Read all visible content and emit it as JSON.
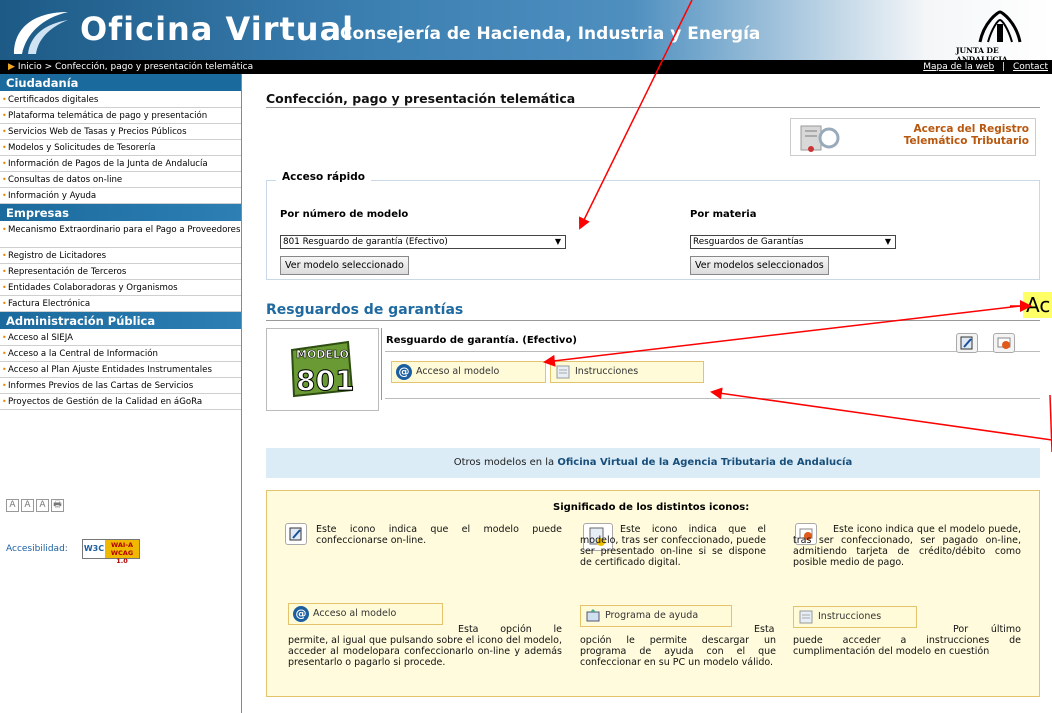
{
  "header": {
    "title": "Oficina Virtual",
    "subtitle": "Consejería de Hacienda, Industria y Energía",
    "junta_label": "JUNTA DE ANDALUCIA"
  },
  "navbar": {
    "breadcrumb": "Inicio > Confección, pago y presentación telemática",
    "links": [
      "Mapa de la web",
      "Contact"
    ],
    "separator": "|"
  },
  "sidebar": {
    "sections": [
      {
        "title": "Ciudadanía",
        "items": [
          "Certificados digitales",
          "Plataforma telemática de pago y presentación",
          "Servicios Web de Tasas y Precios Públicos",
          "Modelos y Solicitudes de Tesorería",
          "Información de Pagos de la Junta de Andalucía",
          "Consultas de datos on-line",
          "Información y Ayuda"
        ]
      },
      {
        "title": "Empresas",
        "items": [
          "Mecanismo Extraordinario para el Pago a Proveedores",
          "Registro de Licitadores",
          "Representación de Terceros",
          "Entidades Colaboradoras y Organismos",
          "Factura Electrónica"
        ]
      },
      {
        "title": "Administración Pública",
        "items": [
          "Acceso al SIEJA",
          "Acceso a la Central de Información",
          "Acceso al Plan Ajuste Entidades Instrumentales",
          "Informes Previos de las Cartas de Servicios",
          "Proyectos de Gestión de la Calidad en áGoRa"
        ]
      }
    ],
    "font_buttons": [
      "A",
      "A",
      "A",
      "🖶"
    ],
    "accesibilidad_label": "Accesibilidad:",
    "wai_badge": {
      "w3c": "W3C",
      "level": "WAI-A",
      "wcag": "WCAG 1.0"
    }
  },
  "main": {
    "page_title": "Confección, pago y presentación telemática",
    "registro_link": {
      "line1": "Acerca del Registro",
      "line2": "Telemático Tributario"
    },
    "quick_access": {
      "legend": "Acceso rápido",
      "by_model_label": "Por número de modelo",
      "by_model_value": "801 Resguardo de garantía (Efectivo)",
      "by_model_button": "Ver modelo seleccionado",
      "by_subject_label": "Por materia",
      "by_subject_value": "Resguardos de Garantías",
      "by_subject_button": "Ver modelos seleccionados"
    },
    "section_title": "Resguardos de garantías",
    "model": {
      "badge_word": "MODELO",
      "number": "801",
      "title": "Resguardo de garantía. (Efectivo)",
      "access_button": "Acceso al modelo",
      "instructions_button": "Instrucciones"
    },
    "otros": {
      "prefix": "Otros modelos en la",
      "link": "Oficina Virtual de la Agencia Tributaria de Andalucía"
    },
    "legend": {
      "title": "Significado de los distintos iconos:",
      "col1": "Este icono indica que el modelo puede confeccionarse on-line.",
      "col2": "Este icono indica que el modelo, tras ser confeccionado, puede ser presentado on-line si se dispone de certificado digital.",
      "col3": "Este icono indica que el modelo puede, tras ser confeccionado, ser pagado on-line, admitiendo tarjeta de crédito/débito como posible medio de pago.",
      "btn1": "Acceso al modelo",
      "btn1_text": "Esta opción le permite, al igual que pulsando sobre el icono del modelo, acceder al modelopara confeccionarlo on-line y además presentarlo o pagarlo si procede.",
      "btn2": "Programa de ayuda",
      "btn2_text": "Esta opción le permite descargar un programa de ayuda con el que confeccionar en su PC un modelo válido.",
      "btn3": "Instrucciones",
      "btn3_text": "Por último puede acceder a instrucciones de cumplimentación del modelo en cuestión"
    },
    "annotation_text": "Ac"
  },
  "colors": {
    "brand": "#1b6a9d",
    "accent": "#e08a00",
    "arrow": "#ff0000",
    "highlight": "#fffbd8"
  }
}
